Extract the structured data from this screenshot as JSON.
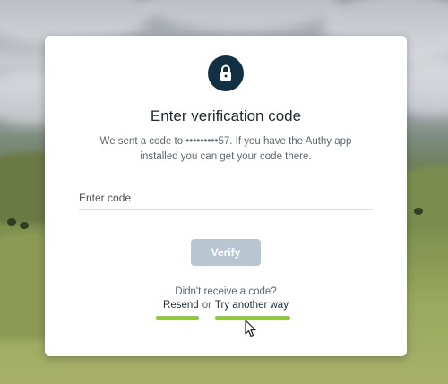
{
  "dialog": {
    "title": "Enter verification code",
    "description": "We sent a code to •••••••••57. If you have the Authy app installed you can get your code there.",
    "code_input": {
      "placeholder": "Enter code",
      "value": ""
    },
    "verify_label": "Verify",
    "no_code_text": "Didn't receive a code?",
    "resend_label": "Resend",
    "or_text": "or",
    "try_another_label": "Try another way",
    "icon": "lock-icon"
  },
  "colors": {
    "icon_bg": "#123044",
    "verify_bg_disabled": "#b8c6d1",
    "annotation_underline": "#8bd12c"
  }
}
